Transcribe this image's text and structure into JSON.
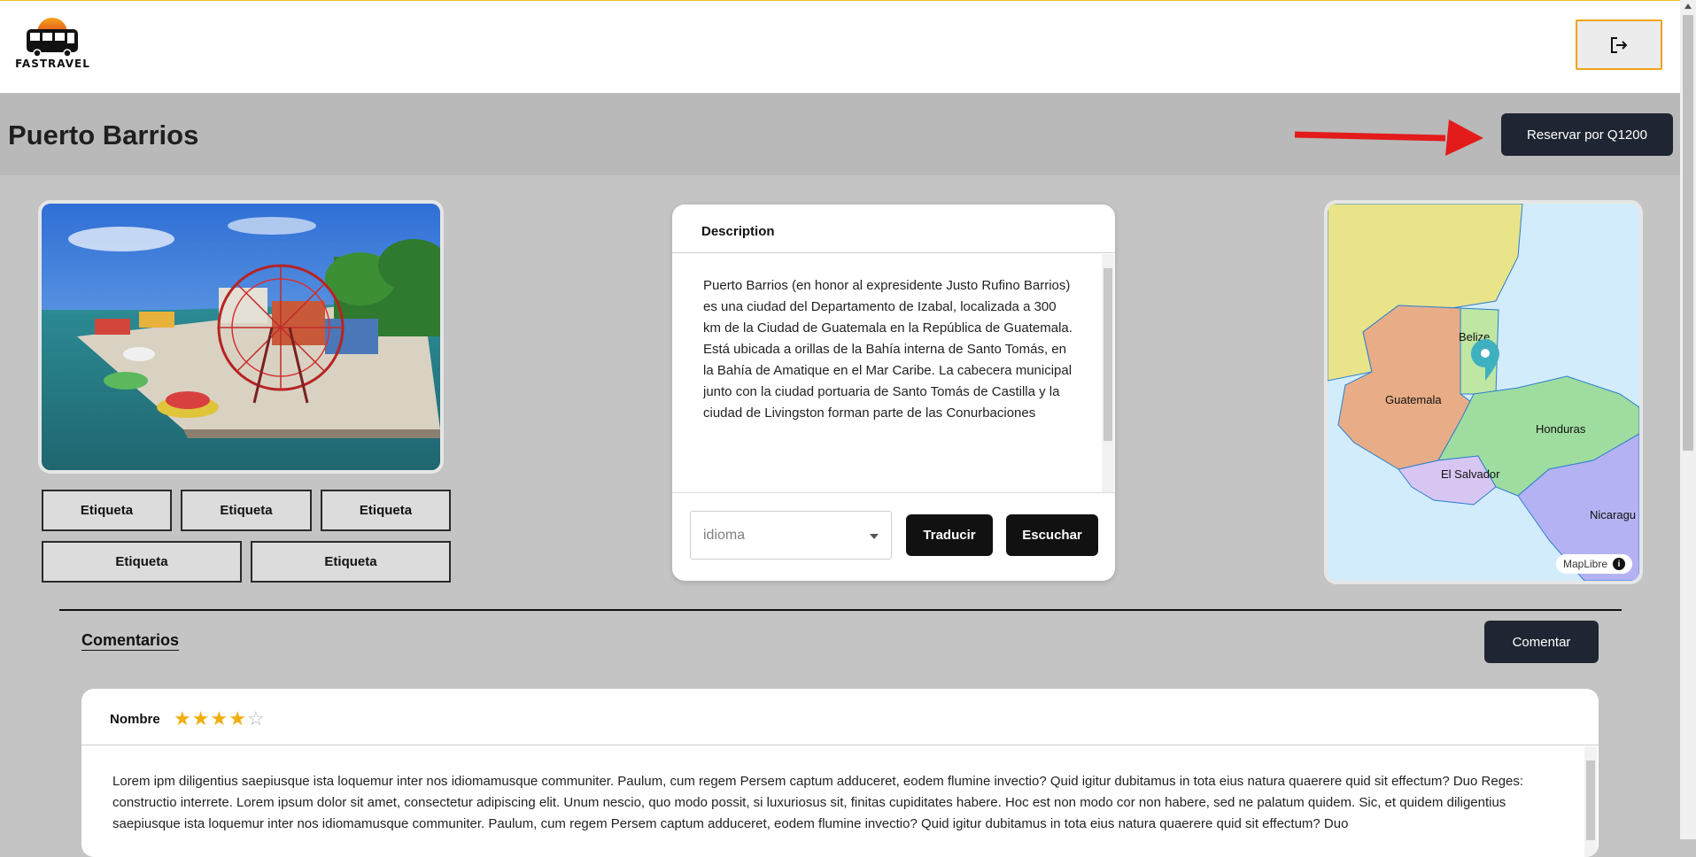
{
  "brand": {
    "name": "FASTRAVEL"
  },
  "header": {
    "logout_icon": "logout-icon"
  },
  "page": {
    "title": "Puerto Barrios",
    "reserve_label": "Reservar por Q1200"
  },
  "tags": [
    "Etiqueta",
    "Etiqueta",
    "Etiqueta",
    "Etiqueta",
    "Etiqueta"
  ],
  "description": {
    "header": "Description",
    "text": "Puerto Barrios (en honor al expresidente Justo Rufino Barrios) es una ciudad del Departamento de Izabal, localizada a 300 km de la Ciudad de Guatemala en la República de Guatemala. Está ubicada a orillas de la Bahía interna de Santo Tomás, en la Bahía de Amatique en el Mar Caribe. La cabecera municipal junto con la ciudad portuaria de Santo Tomás de Castilla y la ciudad de Livingston forman parte de las Conurbaciones urbanas más importantes de Guatemala, debido a sus actividades comerciales, turismo doméstico e internacional y por ser",
    "language_placeholder": "idioma",
    "translate_label": "Traducir",
    "listen_label": "Escuchar"
  },
  "map": {
    "labels": [
      "Belize",
      "Guatemala",
      "Honduras",
      "El Salvador",
      "Nicaragu"
    ],
    "attribution": "MapLibre",
    "info_glyph": "i"
  },
  "comments": {
    "title": "Comentarios",
    "add_label": "Comentar",
    "items": [
      {
        "name": "Nombre",
        "rating": 4,
        "max_rating": 5,
        "text": "Lorem ipm diligentius saepiusque ista loquemur inter nos idiomamusque communiter. Paulum, cum regem Persem captum adduceret, eodem flumine invectio? Quid igitur dubitamus in tota eius natura quaerere quid sit effectum? Duo Reges: constructio interrete. Lorem ipsum dolor sit amet, consectetur adipiscing elit. Unum nescio, quo modo possit, si luxuriosus sit, finitas cupiditates habere. Hoc est non modo cor non habere, sed ne palatum quidem. Sic, et quidem diligentius saepiusque ista loquemur inter nos idiomamusque communiter. Paulum, cum regem Persem captum adduceret, eodem flumine invectio? Quid igitur dubitamus in tota eius natura quaerere quid sit effectum? Duo"
      }
    ]
  },
  "colors": {
    "accent": "#f0a31a",
    "dark_button": "#1f2532",
    "star": "#f1ad0c",
    "arrow": "#e31b1b"
  }
}
